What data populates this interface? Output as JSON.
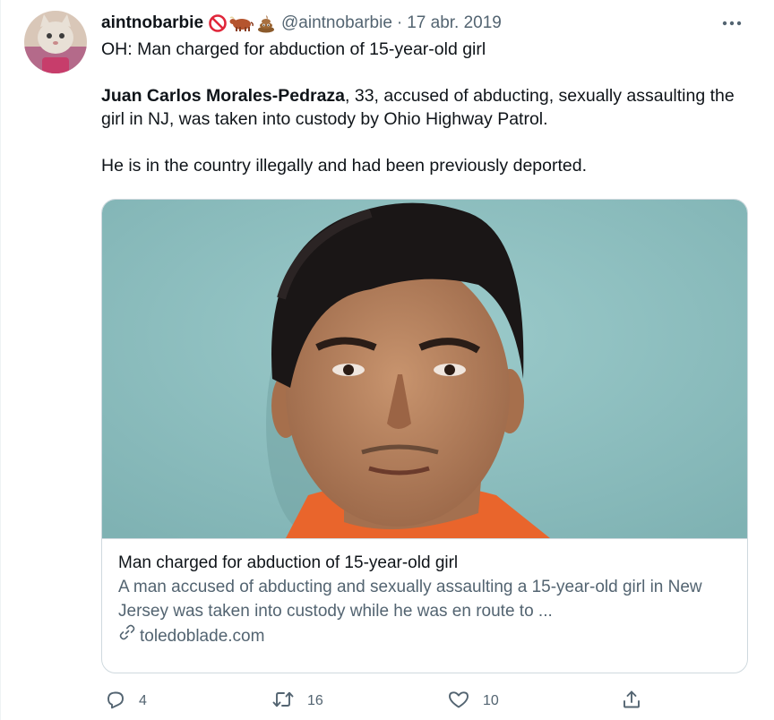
{
  "tweet": {
    "display_name": "aintnobarbie",
    "name_emoji": [
      "no-entry-emoji",
      "ox-emoji",
      "pile-of-poo-emoji"
    ],
    "handle": "@aintnobarbie",
    "separator": "·",
    "date": "17 abr. 2019",
    "more_label": "···",
    "line1": "OH: Man charged for abduction of 15-year-old girl",
    "p2_bold": "Juan Carlos Morales-Pedraza",
    "p2_rest": ", 33, accused of abducting, sexually assaulting the girl in NJ, was taken into custody by Ohio Highway Patrol.",
    "p3": "He is in the country illegally and had been previously deported."
  },
  "card": {
    "title": "Man charged for abduction of 15-year-old girl",
    "description": "A man accused of abducting and sexually assaulting a 15-year-old girl in New Jersey was taken into custody while he was en route to ...",
    "domain": "toledoblade.com",
    "domain_icon": "link-icon"
  },
  "actions": {
    "reply_count": "4",
    "retweet_count": "16",
    "like_count": "10"
  },
  "colors": {
    "text_primary": "#0f1419",
    "text_secondary": "#536471",
    "border": "#cfd9de",
    "photo_background": "#8fc0c0",
    "shirt_orange": "#e9652c"
  }
}
